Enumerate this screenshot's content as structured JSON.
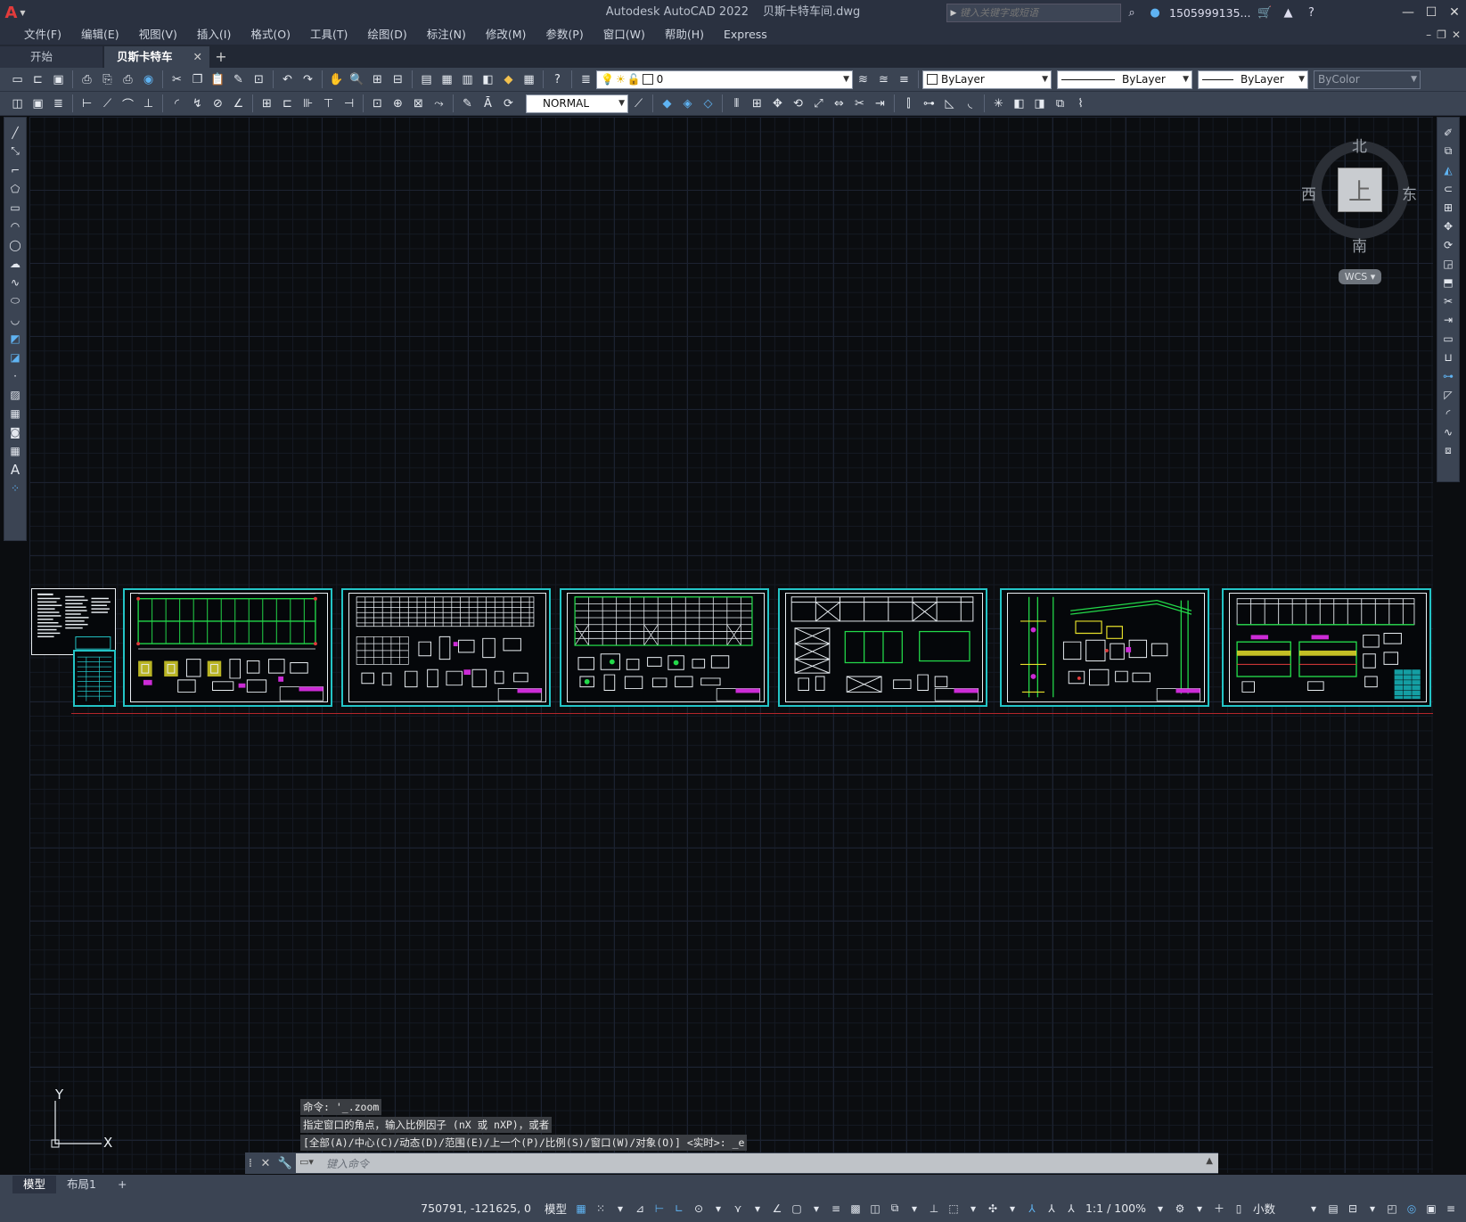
{
  "titlebar": {
    "app_name": "Autodesk AutoCAD 2022",
    "file_name": "贝斯卡特车间.dwg",
    "search_placeholder": "键入关键字或短语",
    "user": "1505999135...",
    "logo": "A"
  },
  "menu": [
    "文件(F)",
    "编辑(E)",
    "视图(V)",
    "插入(I)",
    "格式(O)",
    "工具(T)",
    "绘图(D)",
    "标注(N)",
    "修改(M)",
    "参数(P)",
    "窗口(W)",
    "帮助(H)",
    "Express"
  ],
  "tabs": {
    "start": "开始",
    "active": "贝斯卡特车间*",
    "plus": "+"
  },
  "toolbar1": {
    "layer_value": "0",
    "color_value": "ByLayer",
    "linetype_value": "ByLayer",
    "lineweight_value": "ByLayer",
    "plotstyle_value": "ByColor"
  },
  "toolbar2": {
    "dimstyle_value": "NORMAL"
  },
  "viewcube": {
    "north": "北",
    "south": "南",
    "east": "东",
    "west": "西",
    "face": "上",
    "wcs": "WCS"
  },
  "ucs": {
    "x": "X",
    "y": "Y"
  },
  "command": {
    "history": [
      "命令: '_.zoom",
      "指定窗口的角点，输入比例因子 (nX 或 nXP)，或者",
      "[全部(A)/中心(C)/动态(D)/范围(E)/上一个(P)/比例(S)/窗口(W)/对象(O)] <实时>: _e"
    ],
    "placeholder": "键入命令"
  },
  "layout_tabs": [
    "模型",
    "布局1",
    "+"
  ],
  "status": {
    "coords": "750791, -121625, 0",
    "model": "模型",
    "scale": "1:1 / 100%",
    "units": "小数"
  },
  "colors": {
    "sheet_border": "#23c4c6",
    "drawing_green": "#23d94a",
    "grid_major": "#1c2230",
    "axis_red": "#b3262b"
  }
}
